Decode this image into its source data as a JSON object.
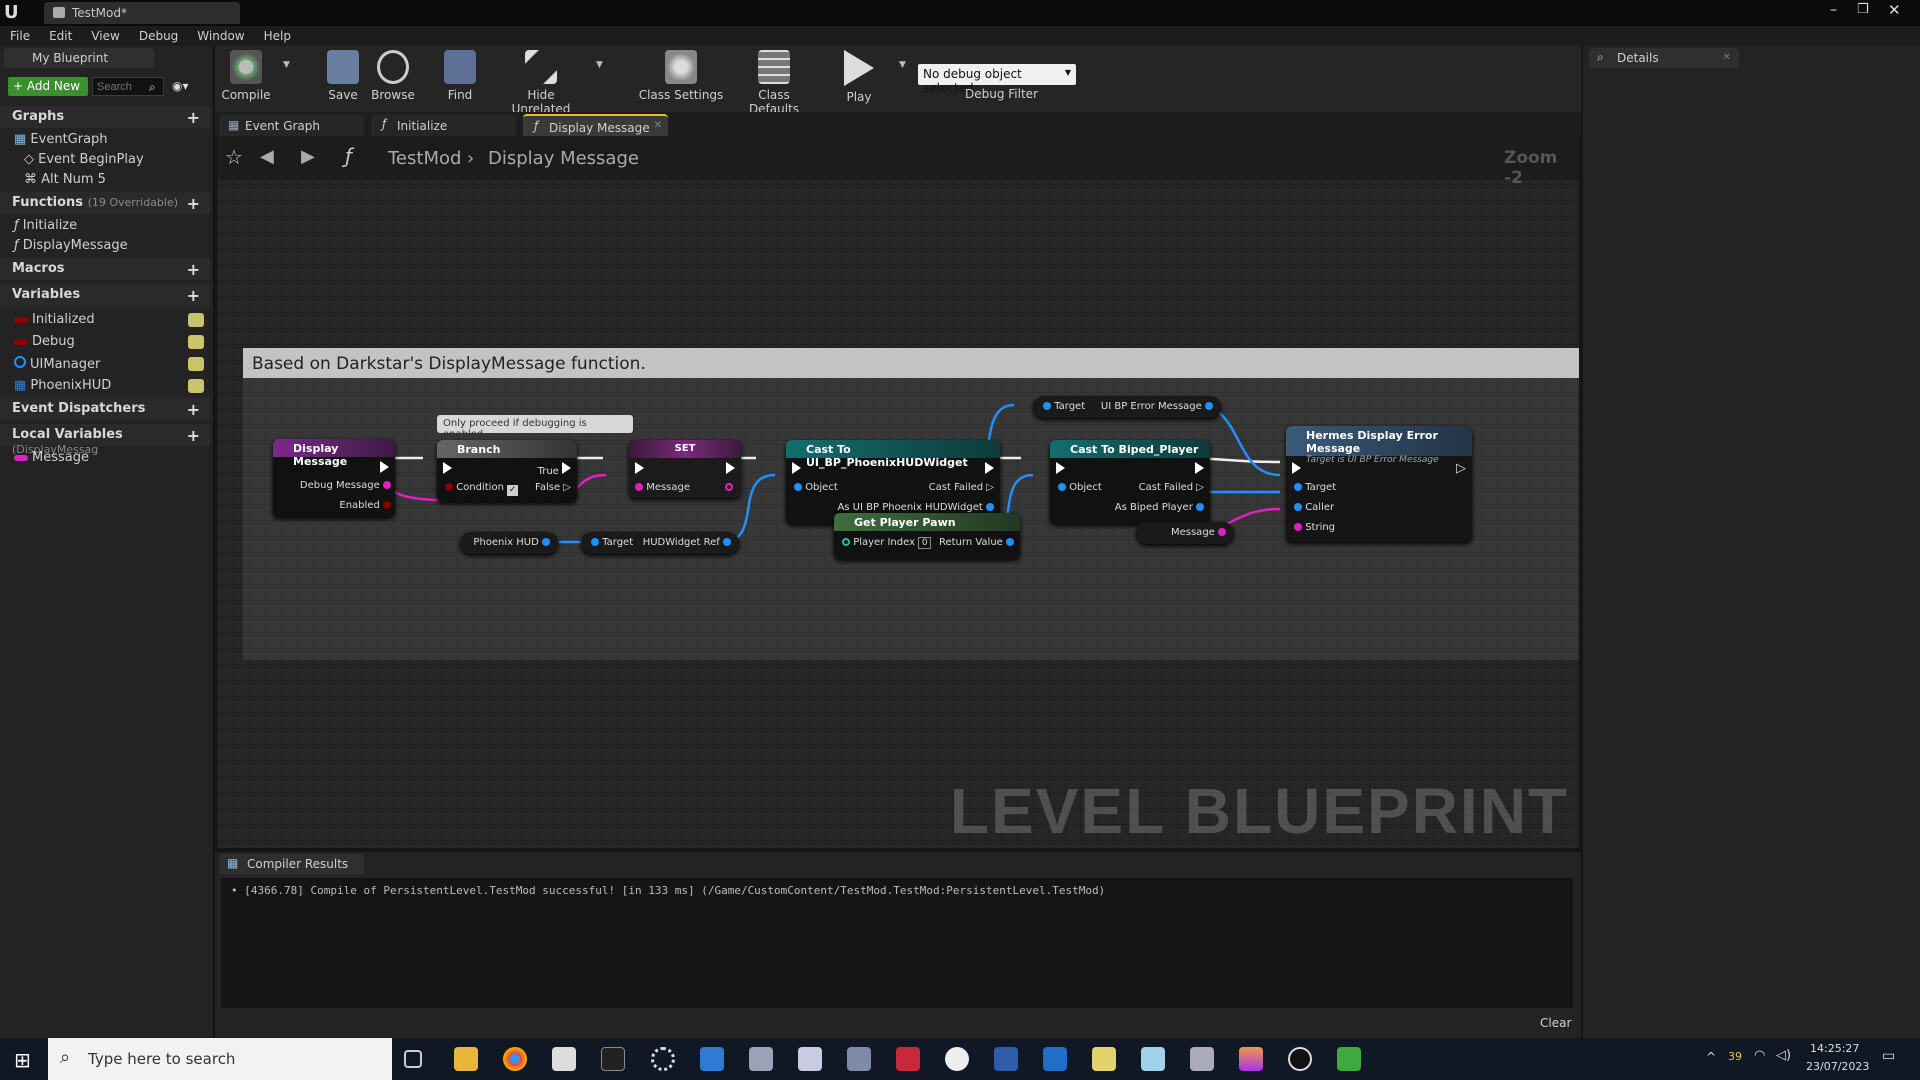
{
  "window": {
    "tab_title": "TestMod*"
  },
  "menu": [
    "File",
    "Edit",
    "View",
    "Debug",
    "Window",
    "Help"
  ],
  "my_blueprint": {
    "title": "My Blueprint",
    "add_new": "+ Add New",
    "search_placeholder": "Search",
    "graphs_header": "Graphs",
    "graph_items": [
      "EventGraph",
      "Event BeginPlay",
      "Alt Num 5"
    ],
    "functions_header": "Functions",
    "functions_note": "(19 Overridable)",
    "function_items": [
      "Initialize",
      "DisplayMessage"
    ],
    "macros_header": "Macros",
    "variables_header": "Variables",
    "variables": [
      {
        "name": "Initialized",
        "color": "#8b0000"
      },
      {
        "name": "Debug",
        "color": "#8b0000"
      },
      {
        "name": "UIManager",
        "color": "#1e90ff"
      },
      {
        "name": "PhoenixHUD",
        "color": "#3a7bd5"
      }
    ],
    "dispatchers_header": "Event Dispatchers",
    "local_header": "Local Variables",
    "local_note": "(DisplayMessag",
    "local_items": [
      "Message"
    ]
  },
  "toolbar": {
    "compile": "Compile",
    "save": "Save",
    "browse": "Browse",
    "find": "Find",
    "hide_unrelated": "Hide Unrelated",
    "class_settings": "Class Settings",
    "class_defaults": "Class Defaults",
    "play": "Play",
    "debug_select": "No debug object selected",
    "debug_filter": "Debug Filter"
  },
  "graph_tabs": [
    "Event Graph",
    "Initialize",
    "Display Message"
  ],
  "breadcrumb": {
    "root": "TestMod",
    "current": "Display Message",
    "zoom": "Zoom -2"
  },
  "comment_title": "Based on Darkstar's DisplayMessage function.",
  "tooltip": "Only proceed if debugging is enabled.",
  "nodes": {
    "display_message": {
      "title": "Display Message",
      "pin1": "Debug Message",
      "pin2": "Enabled"
    },
    "branch": {
      "title": "Branch",
      "cond": "Condition",
      "true": "True",
      "false": "False"
    },
    "set": {
      "title": "SET",
      "pin": "Message"
    },
    "cast_hud": {
      "title": "Cast To UI_BP_PhoenixHUDWidget",
      "obj": "Object",
      "failed": "Cast Failed",
      "out": "As UI BP Phoenix HUDWidget"
    },
    "cast_player": {
      "title": "Cast To Biped_Player",
      "obj": "Object",
      "failed": "Cast Failed",
      "out": "As Biped Player"
    },
    "target_err": {
      "target": "Target",
      "out": "UI BP Error Message"
    },
    "hermes": {
      "title": "Hermes Display Error Message",
      "sub": "Target is UI BP Error Message",
      "target": "Target",
      "caller": "Caller",
      "string": "String"
    },
    "phoenix_hud": {
      "label": "Phoenix HUD"
    },
    "hudwidget": {
      "target": "Target",
      "out": "HUDWidget Ref"
    },
    "get_pawn": {
      "title": "Get Player Pawn",
      "index_label": "Player Index",
      "index_val": "0",
      "ret": "Return Value"
    },
    "message_getter": {
      "label": "Message"
    }
  },
  "watermark": "LEVEL BLUEPRINT",
  "details": {
    "title": "Details"
  },
  "compiler": {
    "tab": "Compiler Results",
    "log": "[4366.78] Compile of PersistentLevel.TestMod successful! [in 133 ms] (/Game/CustomContent/TestMod.TestMod:PersistentLevel.TestMod)",
    "clear": "Clear"
  },
  "taskbar": {
    "search": "Type here to search",
    "temp": "39",
    "time": "14:25:27",
    "date": "23/07/2023"
  }
}
